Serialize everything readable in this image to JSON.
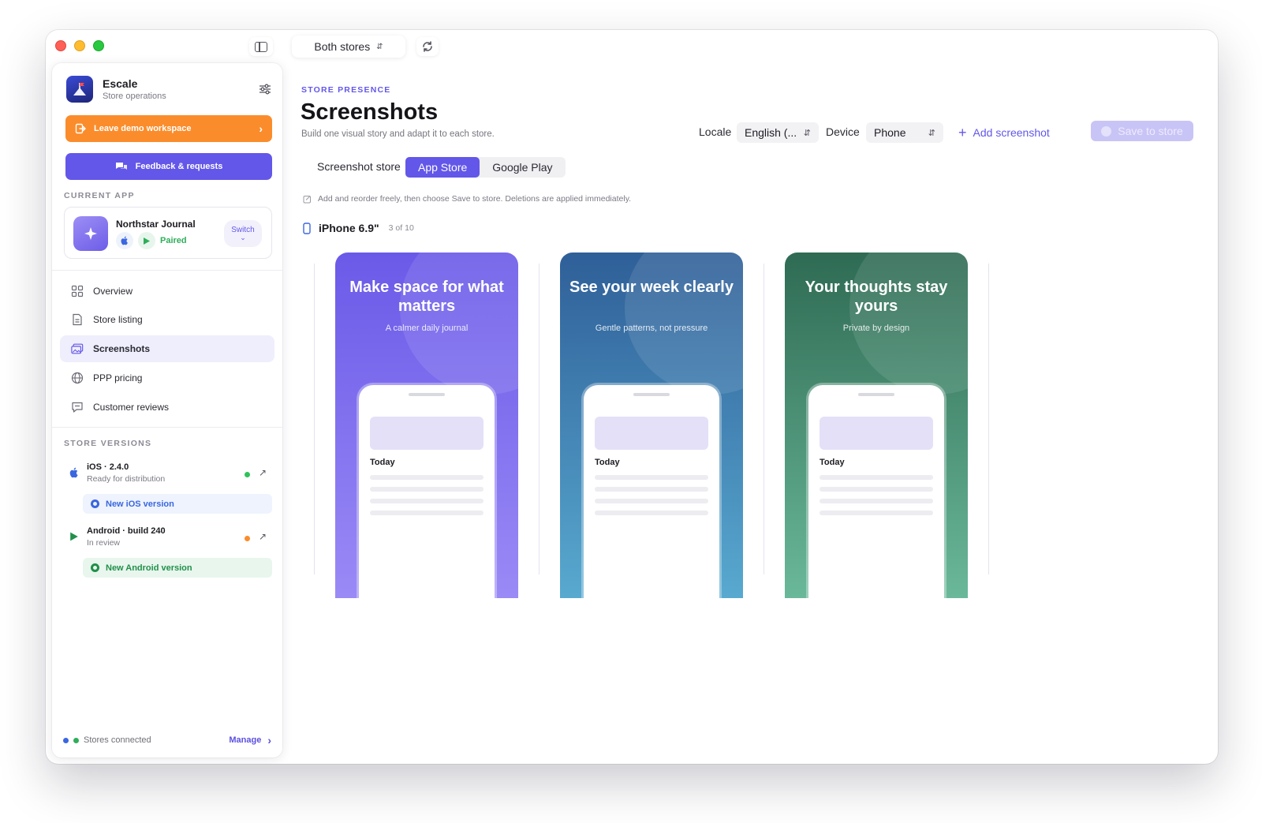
{
  "window": {
    "store_filter": "Both stores"
  },
  "sidebar": {
    "brand": {
      "name": "Escale",
      "subtitle": "Store operations"
    },
    "leave_demo_label": "Leave demo workspace",
    "feedback_label": "Feedback & requests",
    "current_app_heading": "CURRENT APP",
    "current_app": {
      "name": "Northstar Journal",
      "status": "Paired",
      "switch_label": "Switch"
    },
    "nav": [
      {
        "label": "Overview",
        "icon": "grid-icon",
        "active": false
      },
      {
        "label": "Store listing",
        "icon": "document-icon",
        "active": false
      },
      {
        "label": "Screenshots",
        "icon": "images-icon",
        "active": true
      },
      {
        "label": "PPP pricing",
        "icon": "globe-icon",
        "active": false
      },
      {
        "label": "Customer reviews",
        "icon": "chat-icon",
        "active": false
      }
    ],
    "store_versions_heading": "STORE VERSIONS",
    "versions": [
      {
        "title": "iOS · 2.4.0",
        "status": "Ready for distribution",
        "dot_color": "#2fc25b",
        "new_label": "New iOS version"
      },
      {
        "title": "Android · build 240",
        "status": "In review",
        "dot_color": "#fb8c2b",
        "new_label": "New Android version"
      }
    ],
    "footer": {
      "status": "Stores connected",
      "manage_label": "Manage"
    }
  },
  "main": {
    "eyebrow": "STORE PRESENCE",
    "title": "Screenshots",
    "subtitle": "Build one visual story and adapt it to each store.",
    "locale_label": "Locale",
    "locale_value": "English (...",
    "device_label": "Device",
    "device_value": "Phone",
    "add_screenshot_label": "Add screenshot",
    "save_to_store_label": "Save to store",
    "screenshot_store_label": "Screenshot store",
    "store_tabs": [
      {
        "label": "App Store",
        "active": true
      },
      {
        "label": "Google Play",
        "active": false
      }
    ],
    "hint": "Add and reorder freely, then choose Save to store. Deletions are applied immediately.",
    "device_group": {
      "name": "iPhone 6.9\"",
      "count": "3 of 10"
    },
    "screenshots": [
      {
        "headline": "Make space for what matters",
        "tagline": "A calmer daily journal",
        "phone_section": "Today",
        "gradient": [
          "#6a5ae8",
          "#9a8af6"
        ]
      },
      {
        "headline": "See your week clearly",
        "tagline": "Gentle patterns, not pressure",
        "phone_section": "Today",
        "gradient": [
          "#2f5f98",
          "#58a9d0"
        ]
      },
      {
        "headline": "Your thoughts stay yours",
        "tagline": "Private by design",
        "phone_section": "Today",
        "gradient": [
          "#2f6b54",
          "#6ab89a"
        ]
      }
    ]
  },
  "colors": {
    "accent": "#6357e9",
    "orange": "#fb8c2b",
    "ios_blue": "#3a67e0",
    "android_green": "#21904a"
  }
}
